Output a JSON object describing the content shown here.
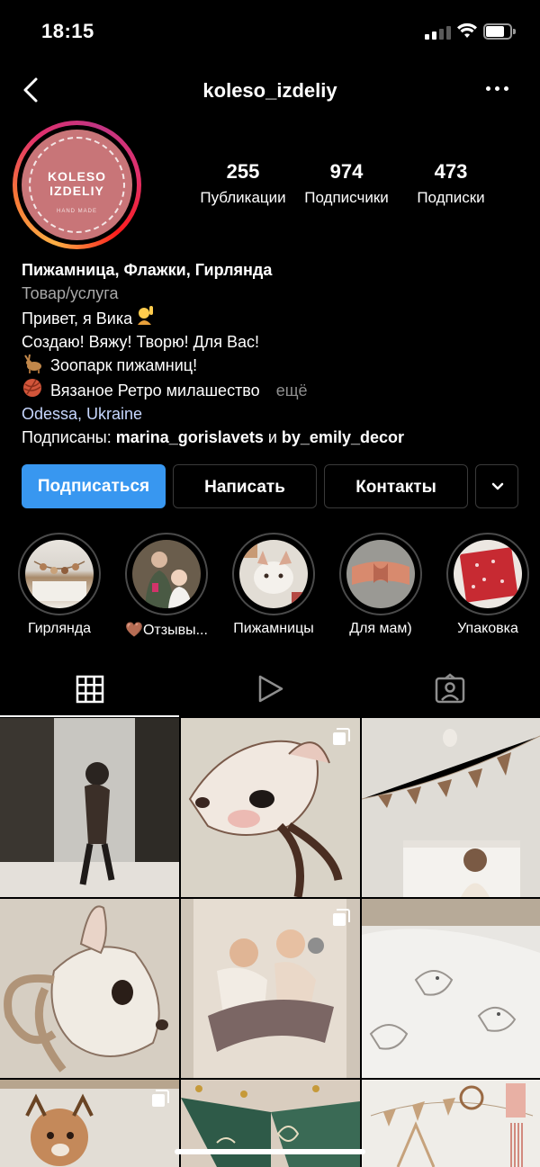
{
  "status_bar": {
    "time": "18:15",
    "battery_level": 0.75
  },
  "nav": {
    "title": "koleso_izdeliy",
    "back_icon": "chevron-left-icon",
    "more_icon": "ellipsis-icon"
  },
  "avatar": {
    "line1": "KOLESO",
    "line2": "IZDELIY",
    "line3": "HAND MADE"
  },
  "stats": [
    {
      "value": "255",
      "label": "Публикации"
    },
    {
      "value": "974",
      "label": "Подписчики"
    },
    {
      "value": "473",
      "label": "Подписки"
    }
  ],
  "bio": {
    "name": "Пижамница, Флажки, Гирлянда",
    "category": "Товар/услуга",
    "line1": "Привет, я Вика",
    "line2": "Создаю! Вяжу! Творю! Для Вас!",
    "line3": "Зоопарк пижамниц!",
    "line4": "Вязаное Ретро милашество",
    "more": "ещё",
    "location": "Odessa, Ukraine",
    "followed_prefix": "Подписаны: ",
    "followed_user1": "marina_gorislavets",
    "followed_and": " и ",
    "followed_user2": "by_emily_decor"
  },
  "buttons": {
    "follow": "Подписаться",
    "message": "Написать",
    "contacts": "Контакты"
  },
  "highlights": [
    {
      "label": "Гирлянда"
    },
    {
      "label": "🤎Отзывы..."
    },
    {
      "label": "Пижамницы"
    },
    {
      "label": "Для мам)"
    },
    {
      "label": "Упаковка"
    }
  ],
  "tabs": [
    "grid-icon",
    "reels-icon",
    "tagged-icon"
  ],
  "colors": {
    "accent": "#3897f0",
    "avatar_bg": "#c87578"
  }
}
